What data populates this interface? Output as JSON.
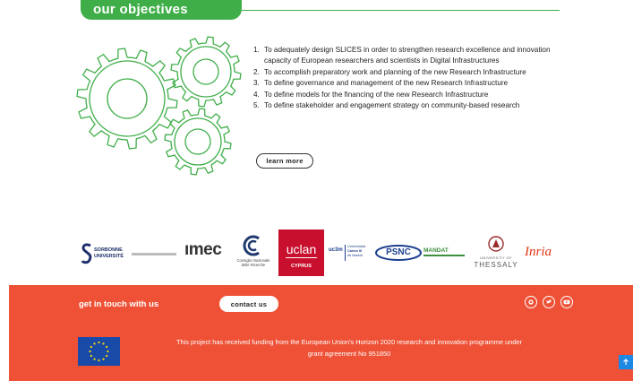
{
  "objectives": {
    "heading": "our objectives",
    "items": [
      {
        "num": "1.",
        "text": "To adequately design SLICES in order to strengthen research excellence and innovation capacity of European researchers and scientists in Digital Infrastructures"
      },
      {
        "num": "2.",
        "text": "To accomplish preparatory work and planning of the new Research Infrastructure"
      },
      {
        "num": "3.",
        "text": "To define governance and management of the new Research Infrastructure"
      },
      {
        "num": "4.",
        "text": "To define models for the financing of the new Research Infrastructure"
      },
      {
        "num": "5.",
        "text": "To define stakeholder and engagement strategy on community-based research"
      }
    ],
    "learn_more": "learn more"
  },
  "logos": {
    "sorbonne": {
      "line1": "SORBONNE",
      "line2": "UNIVERSITÉ"
    },
    "imec": "ımec",
    "cnr": {
      "line1": "Consiglio Nazionale",
      "line2": "delle Ricerche"
    },
    "uclan": {
      "name": "uclan",
      "country": "CYPRUS"
    },
    "uc3m": {
      "abbr": "uc3m",
      "line1": "Universidad",
      "line2": "Carlos III",
      "line3": "de Madrid"
    },
    "psnc": "PSNC",
    "mandat": "MANDAT",
    "thessaly": {
      "line1": "UNIVERSITY OF",
      "line2": "THESSALY"
    },
    "inria": "Inria"
  },
  "footer": {
    "get_in_touch": "get in touch with us",
    "contact_us": "contact us",
    "funding_line1": "This project has received funding from the European Union's Horizon 2020 research and innovation programme under",
    "funding_line2": "grant agreement No 951850"
  },
  "colors": {
    "accent_green": "#3fae49",
    "footer_red": "#ee5136",
    "scroll_blue": "#1e88e5"
  }
}
